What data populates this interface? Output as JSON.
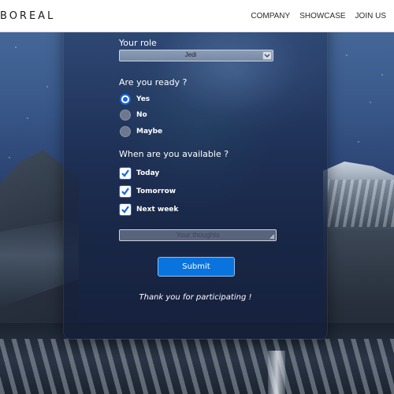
{
  "nav": {
    "brand": "BOREAL",
    "links": [
      "COMPANY",
      "SHOWCASE",
      "JOIN US"
    ]
  },
  "form": {
    "role": {
      "label": "Your role",
      "selected": "Jedi"
    },
    "ready": {
      "label": "Are you ready ?",
      "options": [
        {
          "label": "Yes",
          "checked": true
        },
        {
          "label": "No",
          "checked": false
        },
        {
          "label": "Maybe",
          "checked": false
        }
      ]
    },
    "availability": {
      "label": "When are you available ?",
      "options": [
        {
          "label": "Today",
          "checked": true
        },
        {
          "label": "Tomorrow",
          "checked": true
        },
        {
          "label": "Next week",
          "checked": true
        }
      ]
    },
    "thoughts": {
      "placeholder": "Your thoughts"
    },
    "submit_label": "Submit",
    "thanks": "Thank you for participating !"
  },
  "colors": {
    "accent": "#0a74de",
    "check": "#1a66d8",
    "nav_bg": "#ffffff"
  }
}
